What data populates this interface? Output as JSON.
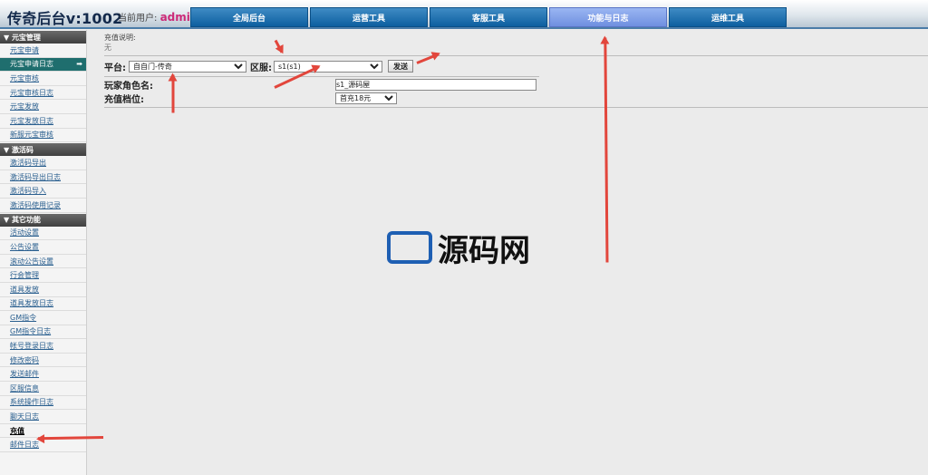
{
  "header": {
    "app_title": "传奇后台v:1002",
    "user_label": "当前用户:",
    "user_name": "admin"
  },
  "nav": {
    "tabs": [
      {
        "label": "全局后台",
        "active": false
      },
      {
        "label": "运营工具",
        "active": false
      },
      {
        "label": "客服工具",
        "active": false
      },
      {
        "label": "功能与日志",
        "active": true
      },
      {
        "label": "运维工具",
        "active": false
      }
    ]
  },
  "sidebar": {
    "sections": [
      {
        "title": "▼ 元宝管理",
        "items": [
          "元宝申请",
          "元宝申请日志",
          "元宝审核",
          "元宝审核日志",
          "元宝发放",
          "元宝发放日志",
          "新服元宝审核"
        ]
      },
      {
        "title": "▼ 激活码",
        "items": [
          "激活码导出",
          "激活码导出日志",
          "激活码导入",
          "激活码使用记录"
        ]
      },
      {
        "title": "▼ 其它功能",
        "items": [
          "活动设置",
          "公告设置",
          "滚动公告设置",
          "行会管理",
          "道具发放",
          "道具发放日志",
          "GM指令",
          "GM指令日志",
          "帐号登录日志",
          "修改密码",
          "发送邮件",
          "区服信息",
          "系统操作日志",
          "聊天日志",
          "充值",
          "邮件日志"
        ]
      }
    ],
    "active_item": "元宝申请日志",
    "current_item": "充值",
    "active_arrow": "➡"
  },
  "main": {
    "notice_title": "充值说明:",
    "notice_text": "无",
    "platform_label": "平台:",
    "platform_value": "自自门-传奇",
    "server_label": "区服:",
    "server_value": "s1(s1)",
    "send_button": "发送",
    "role_label": "玩家角色名:",
    "role_value": "s1_源码屋",
    "tier_label": "充值档位:",
    "tier_value": "首充18元"
  },
  "watermark": {
    "text": "源码网"
  },
  "colors": {
    "nav_tab": "#0d5fa0",
    "nav_tab_active": "#6f8fe0",
    "section_head": "#3f3f3f",
    "sidebar_active": "#1f6e6e",
    "annotation_arrow": "#e2463c"
  }
}
